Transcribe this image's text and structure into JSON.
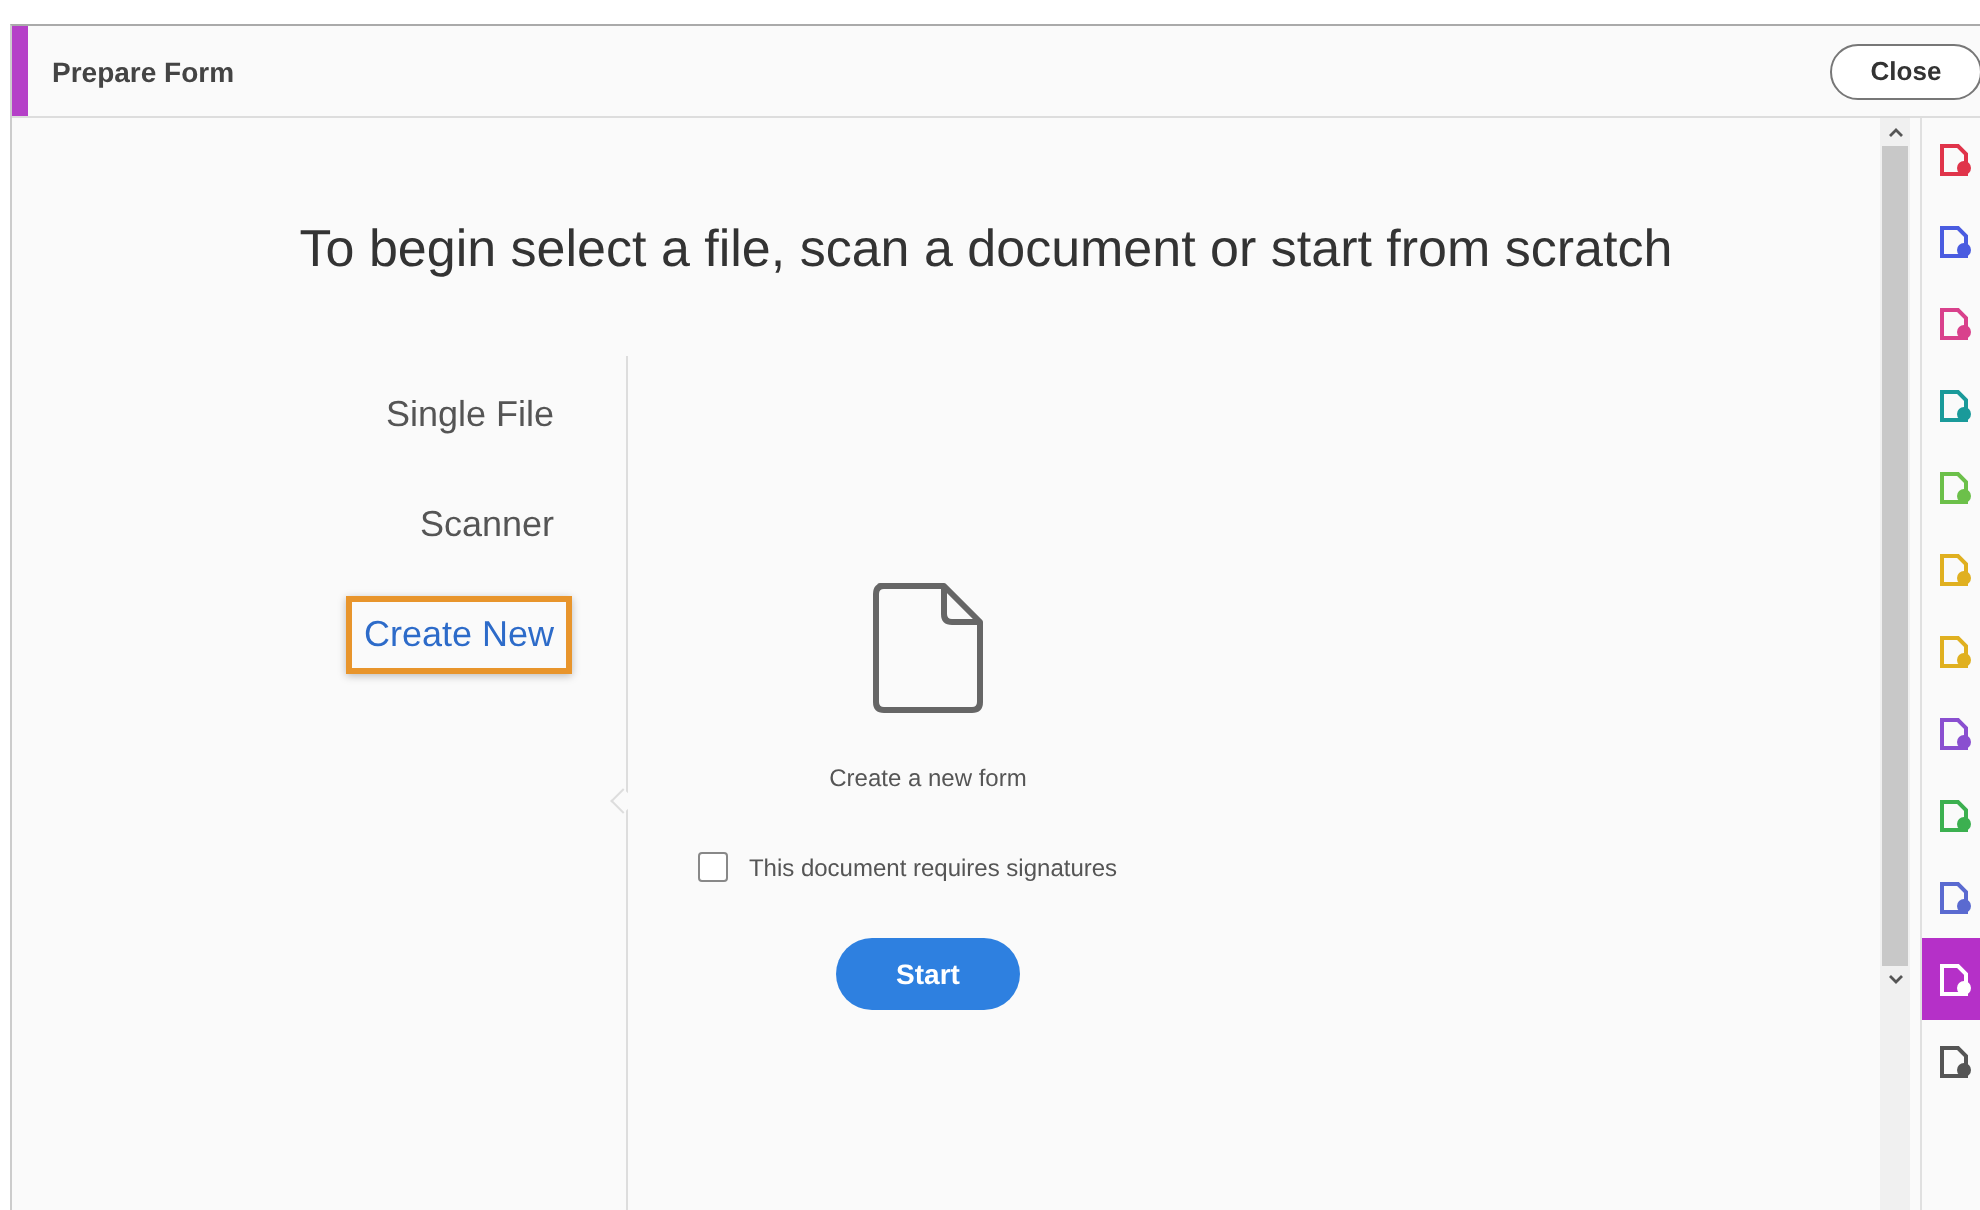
{
  "window": {
    "title": "Prepare Form",
    "close_button": "Close"
  },
  "heading": "To begin select a file, scan a document or start from scratch",
  "sources": [
    {
      "label": "Single File",
      "selected": false
    },
    {
      "label": "Scanner",
      "selected": false
    },
    {
      "label": "Create New",
      "selected": true
    }
  ],
  "create_panel": {
    "caption": "Create a new form",
    "signatures_checkbox": {
      "label": "This document requires signatures",
      "checked": false
    },
    "start_button": "Start"
  },
  "tools": [
    {
      "color": "#e0344a",
      "selected": false
    },
    {
      "color": "#4a5ce0",
      "selected": false
    },
    {
      "color": "#d9418c",
      "selected": false
    },
    {
      "color": "#1a9a9a",
      "selected": false
    },
    {
      "color": "#6cc04a",
      "selected": false
    },
    {
      "color": "#e0b020",
      "selected": false
    },
    {
      "color": "#e0b020",
      "selected": false
    },
    {
      "color": "#8a4fd0",
      "selected": false
    },
    {
      "color": "#3cb050",
      "selected": false
    },
    {
      "color": "#5a6ad0",
      "selected": false
    },
    {
      "color": "#b530c8",
      "selected": true
    },
    {
      "color": "#555555",
      "selected": false
    }
  ]
}
